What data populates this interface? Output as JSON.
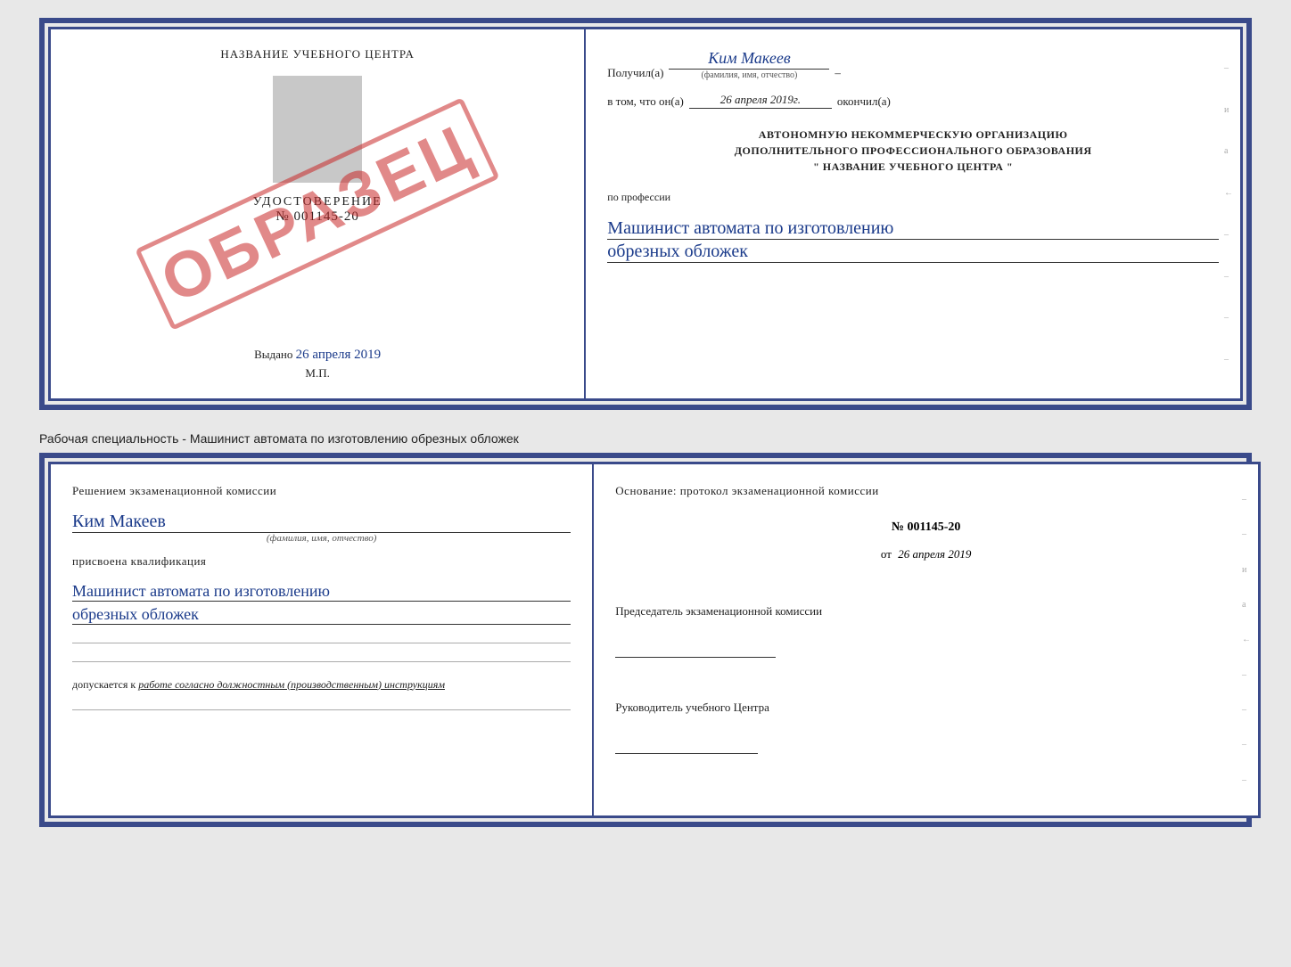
{
  "top_cert": {
    "left": {
      "school_name": "НАЗВАНИЕ УЧЕБНОГО ЦЕНТРА",
      "stamp": "ОБРАЗЕЦ",
      "doc_type": "УДОСТОВЕРЕНИЕ",
      "doc_number": "№ 001145-20",
      "vydano_label": "Выдано",
      "vydano_date": "26 апреля 2019",
      "mp": "М.П."
    },
    "right": {
      "received_label": "Получил(а)",
      "received_name": "Ким Макеев",
      "name_caption": "(фамилия, имя, отчество)",
      "in_that_prefix": "в том, что он(а)",
      "completion_date": "26 апреля 2019г.",
      "finished_label": "окончил(а)",
      "org_line1": "АВТОНОМНУЮ НЕКОММЕРЧЕСКУЮ ОРГАНИЗАЦИЮ",
      "org_line2": "ДОПОЛНИТЕЛЬНОГО ПРОФЕССИОНАЛЬНОГО ОБРАЗОВАНИЯ",
      "org_line3": "\"   НАЗВАНИЕ УЧЕБНОГО ЦЕНТРА   \"",
      "profession_label": "по профессии",
      "profession_name": "Машинист автомата по изготовлению",
      "profession_name2": "обрезных обложек"
    }
  },
  "separator": {
    "text": "Рабочая специальность - Машинист автомата по изготовлению обрезных обложек"
  },
  "bottom_cert": {
    "left": {
      "decision_label": "Решением экзаменационной комиссии",
      "person_name": "Ким Макеев",
      "name_caption": "(фамилия, имя, отчество)",
      "qualification_label": "присвоена квалификация",
      "qualification_name": "Машинист автомата по изготовлению",
      "qualification_name2": "обрезных обложек",
      "allowed_prefix": "допускается к",
      "allowed_text": "работе согласно должностным (производственным) инструкциям"
    },
    "right": {
      "basis_label": "Основание: протокол экзаменационной комиссии",
      "protocol_number": "№  001145-20",
      "date_prefix": "от",
      "date_value": "26 апреля 2019",
      "commission_chair_label": "Председатель экзаменационной комиссии",
      "center_head_label": "Руководитель учебного Центра"
    }
  }
}
